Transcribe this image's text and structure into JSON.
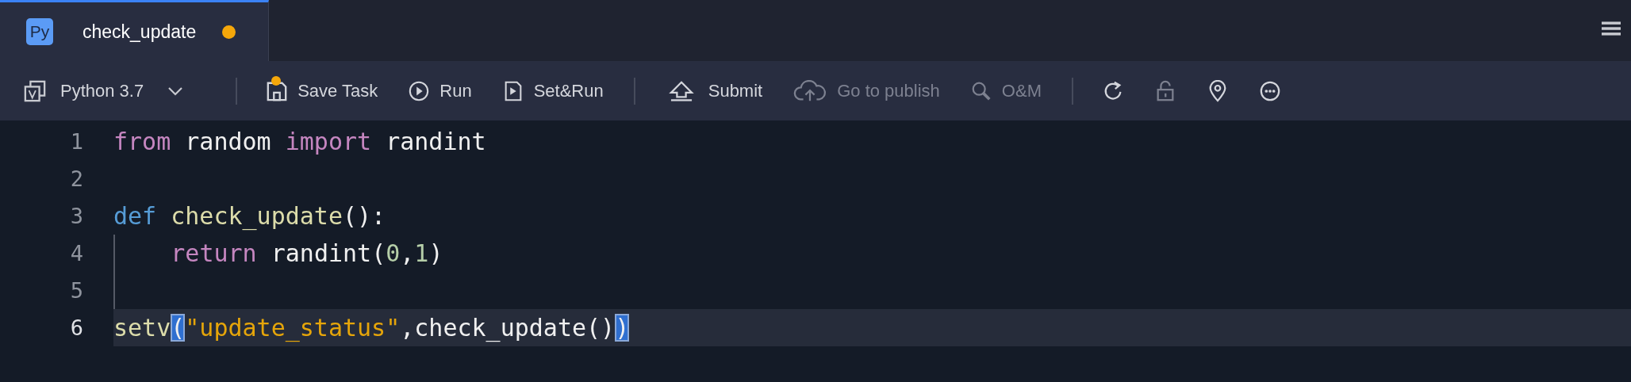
{
  "tabs": [
    {
      "badge": "Py",
      "title": "check_update",
      "selected": true,
      "modified": true
    }
  ],
  "toolbar": [
    {
      "kind": "select",
      "label": "Python 3.7"
    },
    {
      "kind": "separator"
    },
    {
      "kind": "button",
      "label": "Save Task",
      "disabled": false,
      "modified": true
    },
    {
      "kind": "button",
      "label": "Run",
      "disabled": false,
      "modified": false
    },
    {
      "kind": "button",
      "label": "Set&Run",
      "disabled": false,
      "modified": false
    },
    {
      "kind": "separator"
    },
    {
      "kind": "button",
      "label": "Submit",
      "disabled": false,
      "modified": false
    },
    {
      "kind": "button",
      "label": "Go to publish",
      "disabled": true,
      "modified": false
    },
    {
      "kind": "button",
      "label": "O&M",
      "disabled": true,
      "modified": false
    },
    {
      "kind": "separator"
    },
    {
      "kind": "icon",
      "disabled": false
    },
    {
      "kind": "icon",
      "disabled": true
    },
    {
      "kind": "icon",
      "disabled": false
    },
    {
      "kind": "icon",
      "disabled": false
    }
  ],
  "editor": {
    "lines": [
      {
        "number": "1",
        "current": false,
        "tokens": [
          {
            "kind": "keyword",
            "text": "from"
          },
          {
            "kind": "plain",
            "text": " random "
          },
          {
            "kind": "keyword",
            "text": "import"
          },
          {
            "kind": "plain",
            "text": " randint"
          }
        ]
      },
      {
        "number": "2",
        "current": false
      },
      {
        "number": "3",
        "current": false,
        "tokens": [
          {
            "kind": "def",
            "text": "def "
          },
          {
            "kind": "function",
            "text": "check_update"
          },
          {
            "kind": "plain",
            "text": "():"
          }
        ]
      },
      {
        "number": "4",
        "current": false,
        "indent": true,
        "tokens": [
          {
            "kind": "keyword",
            "text": "return"
          },
          {
            "kind": "plain",
            "text": " randint("
          },
          {
            "kind": "number",
            "text": "0"
          },
          {
            "kind": "plain",
            "text": ","
          },
          {
            "kind": "number",
            "text": "1"
          },
          {
            "kind": "plain",
            "text": ")"
          }
        ]
      },
      {
        "number": "5",
        "current": false,
        "indent": true
      },
      {
        "number": "6",
        "current": true,
        "tokens": [
          {
            "kind": "function",
            "text": "setv"
          },
          {
            "kind": "bracket",
            "text": "("
          },
          {
            "kind": "string",
            "text": "\"update_status\""
          },
          {
            "kind": "plain",
            "text": ",check_update()"
          },
          {
            "kind": "bracket",
            "text": ")"
          }
        ]
      }
    ]
  }
}
